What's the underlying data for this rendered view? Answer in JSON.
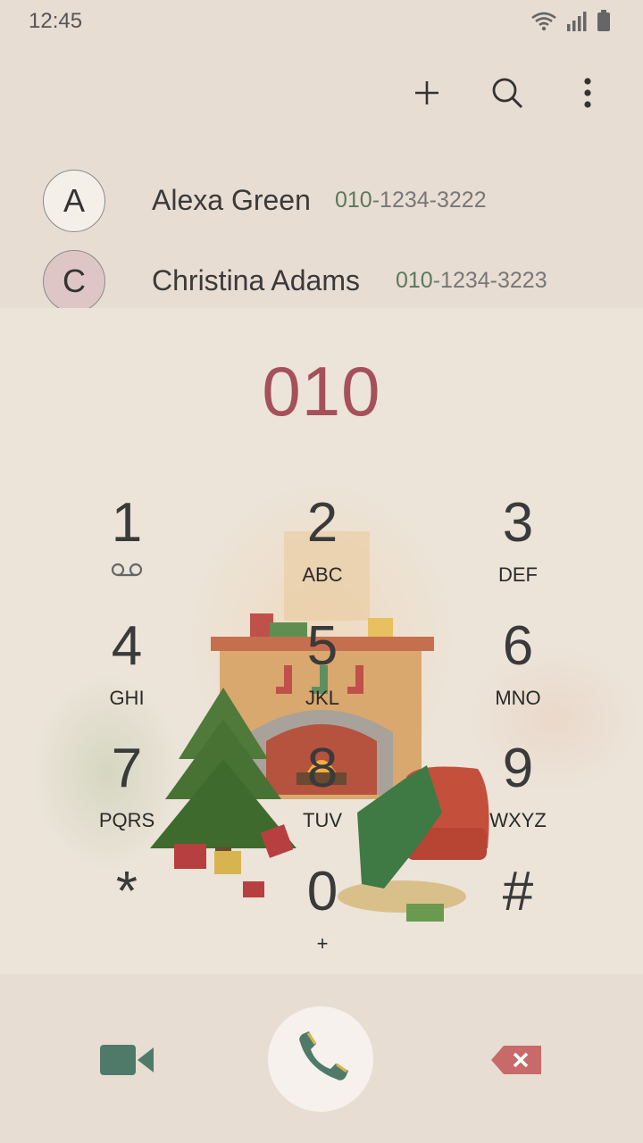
{
  "status": {
    "time": "12:45",
    "icons": [
      "wifi-icon",
      "signal-icon",
      "battery-icon"
    ]
  },
  "toolbar": {
    "add_icon": "plus-icon",
    "search_icon": "search-icon",
    "more_icon": "more-vert-icon"
  },
  "contacts": [
    {
      "initial": "A",
      "name": "Alexa Green",
      "number_match": "010",
      "number_rest": "-1234-3222"
    },
    {
      "initial": "C",
      "name": "Christina Adams",
      "number_match": "010",
      "number_rest": "-1234-3223"
    }
  ],
  "dial": {
    "entered": "010"
  },
  "keys": [
    {
      "digit": "1",
      "letters": "",
      "icon": "voicemail-icon"
    },
    {
      "digit": "2",
      "letters": "ABC"
    },
    {
      "digit": "3",
      "letters": "DEF"
    },
    {
      "digit": "4",
      "letters": "GHI"
    },
    {
      "digit": "5",
      "letters": "JKL"
    },
    {
      "digit": "6",
      "letters": "MNO"
    },
    {
      "digit": "7",
      "letters": "PQRS"
    },
    {
      "digit": "8",
      "letters": "TUV"
    },
    {
      "digit": "9",
      "letters": "WXYZ"
    },
    {
      "digit": "*",
      "letters": ""
    },
    {
      "digit": "0",
      "letters": "+"
    },
    {
      "digit": "#",
      "letters": ""
    }
  ],
  "bottom": {
    "video_icon": "video-call-icon",
    "call_icon": "phone-icon",
    "delete_icon": "backspace-icon"
  },
  "colors": {
    "background": "#e8ddd3",
    "dialed_number": "#a5505a",
    "number_match": "#5a7a5a",
    "action_green": "#4f7a6a",
    "backspace_red": "#c86a6a"
  }
}
